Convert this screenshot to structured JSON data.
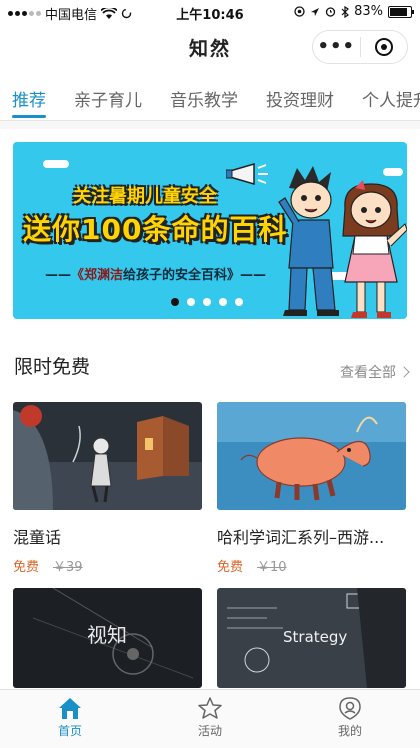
{
  "status_bar": {
    "carrier": "中国电信",
    "time": "上午10:46",
    "battery": "83%",
    "battery_level": 0.83
  },
  "nav": {
    "title": "知然",
    "more_icon": "more-dots-icon",
    "close_icon": "target-close-icon"
  },
  "tabs": [
    {
      "label": "推荐",
      "active": true
    },
    {
      "label": "亲子育儿"
    },
    {
      "label": "音乐教学"
    },
    {
      "label": "投资理财"
    },
    {
      "label": "个人提升"
    }
  ],
  "banner": {
    "line1": "关注暑期儿童安全",
    "line2": "送你100条命的百科",
    "caption_name": "《郑渊洁",
    "caption_rest": "给孩子的安全百科》",
    "dot_count": 5,
    "active_dot": 0,
    "colors": {
      "bg": "#33c8ec",
      "title": "#ffd400"
    }
  },
  "section": {
    "title": "限时免费",
    "see_all": "查看全部"
  },
  "cards": [
    {
      "title": "混童话",
      "free_label": "免费",
      "original_price": "￥39"
    },
    {
      "title": "哈利学词汇系列–西游...",
      "free_label": "免费",
      "original_price": "￥10"
    },
    {
      "thumb_text": "视知"
    },
    {
      "thumb_text": "Strategy"
    }
  ],
  "tabbar": [
    {
      "label": "首页",
      "icon": "home-icon",
      "active": true
    },
    {
      "label": "活动",
      "icon": "star-icon"
    },
    {
      "label": "我的",
      "icon": "profile-icon"
    }
  ],
  "colors": {
    "accent": "#1a8fc8",
    "free": "#d9662a"
  }
}
